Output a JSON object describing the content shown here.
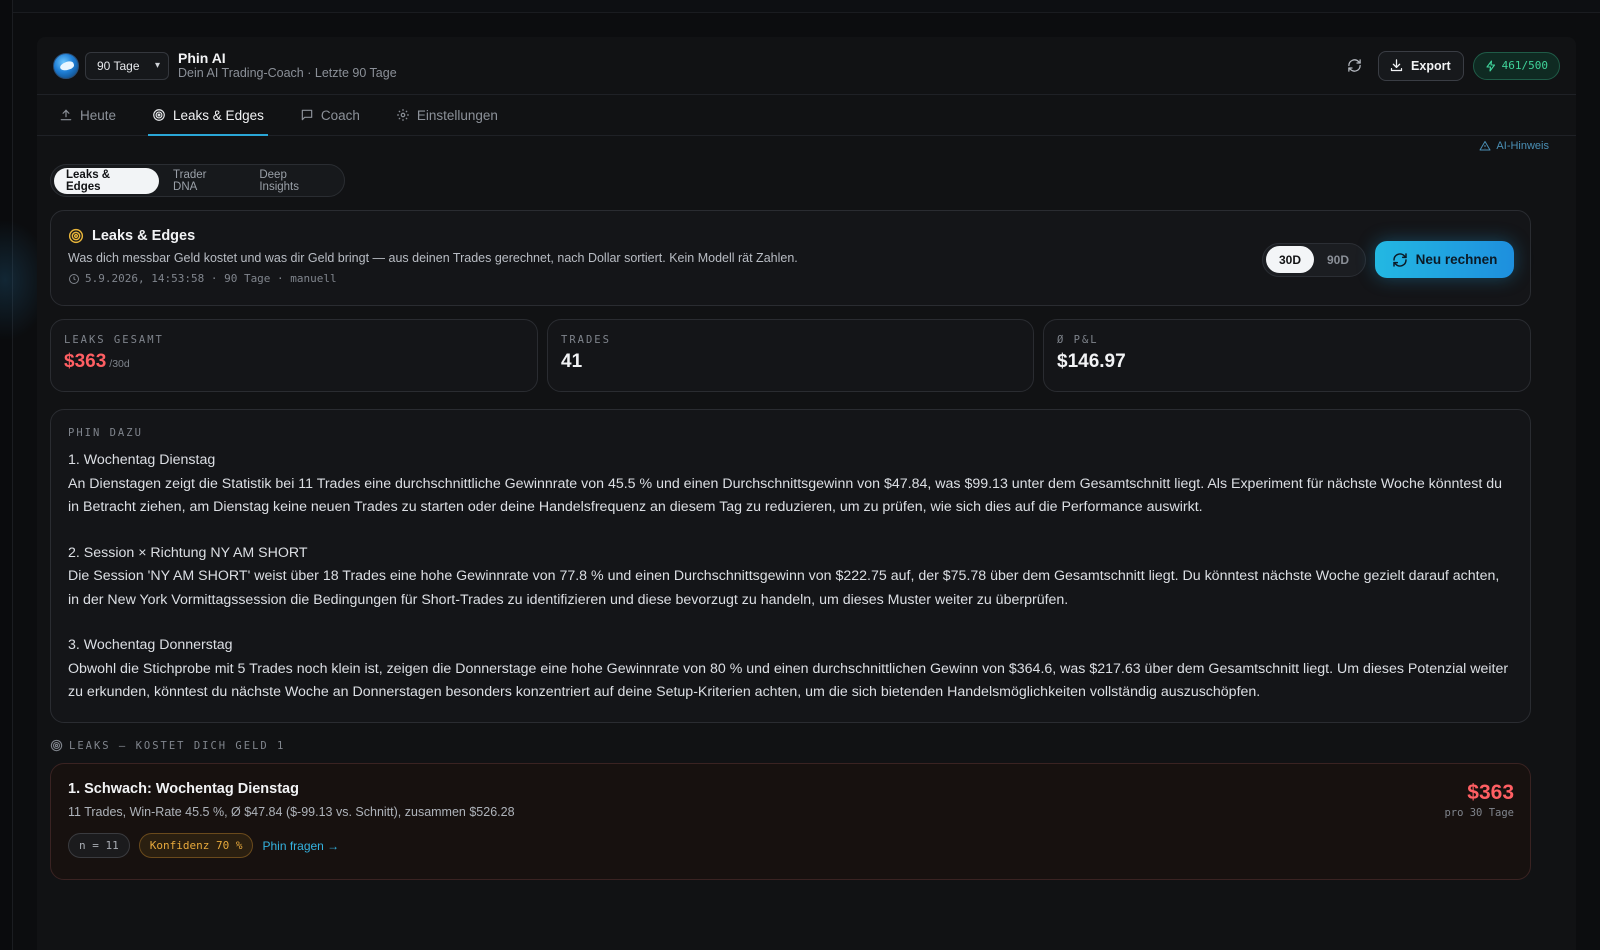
{
  "header": {
    "range_select": "90 Tage",
    "title": "Phin AI",
    "subtitle": "Dein AI Trading-Coach · Letzte 90 Tage",
    "export_label": "Export",
    "quota": "461/500"
  },
  "tabs": [
    {
      "label": "Heute",
      "icon": "upload-icon"
    },
    {
      "label": "Leaks & Edges",
      "icon": "target-icon",
      "active": true
    },
    {
      "label": "Coach",
      "icon": "chat-icon"
    },
    {
      "label": "Einstellungen",
      "icon": "gear-icon"
    }
  ],
  "ai_hint": "AI-Hinweis",
  "subtabs": [
    "Leaks & Edges",
    "Trader DNA",
    "Deep Insights"
  ],
  "hero": {
    "title": "Leaks & Edges",
    "description": "Was dich messbar Geld kostet und was dir Geld bringt — aus deinen Trades gerechnet, nach Dollar sortiert. Kein Modell rät Zahlen.",
    "meta": "5.9.2026, 14:53:58 · 90 Tage · manuell",
    "seg_30": "30D",
    "seg_90": "90D",
    "recalc_label": "Neu rechnen"
  },
  "stats": [
    {
      "label": "LEAKS GESAMT",
      "value": "$363",
      "suffix": "/30d"
    },
    {
      "label": "TRADES",
      "value": "41"
    },
    {
      "label": "Ø P&L",
      "value": "$146.97"
    }
  ],
  "phin": {
    "label": "PHIN DAZU",
    "insights": [
      {
        "heading": "1. Wochentag Dienstag",
        "text": "An Dienstagen zeigt die Statistik bei 11 Trades eine durchschnittliche Gewinnrate von 45.5 % und einen Durchschnittsgewinn von $47.84, was $99.13 unter dem Gesamtschnitt liegt. Als Experiment für nächste Woche könntest du in Betracht ziehen, am Dienstag keine neuen Trades zu starten oder deine Handelsfrequenz an diesem Tag zu reduzieren, um zu prüfen, wie sich dies auf die Performance auswirkt."
      },
      {
        "heading": "2. Session × Richtung NY AM SHORT",
        "text": "Die Session 'NY AM SHORT' weist über 18 Trades eine hohe Gewinnrate von 77.8 % und einen Durchschnittsgewinn von $222.75 auf, der $75.78 über dem Gesamtschnitt liegt. Du könntest nächste Woche gezielt darauf achten, in der New York Vormittagssession die Bedingungen für Short-Trades zu identifizieren und diese bevorzugt zu handeln, um dieses Muster weiter zu überprüfen."
      },
      {
        "heading": "3. Wochentag Donnerstag",
        "text": "Obwohl die Stichprobe mit 5 Trades noch klein ist, zeigen die Donnerstage eine hohe Gewinnrate von 80 % und einen durchschnittlichen Gewinn von $364.6, was $217.63 über dem Gesamtschnitt liegt. Um dieses Potenzial weiter zu erkunden, könntest du nächste Woche an Donnerstagen besonders konzentriert auf deine Setup-Kriterien achten, um die sich bietenden Handelsmöglichkeiten vollständig auszuschöpfen."
      }
    ]
  },
  "leaks": {
    "section_label": "LEAKS — KOSTET DICH GELD 1",
    "items": [
      {
        "title": "1. Schwach: Wochentag Dienstag",
        "description": "11 Trades, Win-Rate 45.5 %, Ø $47.84 ($-99.13 vs. Schnitt), zusammen $526.28",
        "n_tag": "n = 11",
        "confidence_tag": "Konfidenz 70 %",
        "ask_label": "Phin fragen →",
        "amount": "$363",
        "period": "pro 30 Tage"
      }
    ]
  },
  "colors": {
    "accent": "#23b8e2",
    "negative": "#ff5f63",
    "quota_green": "#3fd39a",
    "confidence_amber": "#e7a93c"
  }
}
